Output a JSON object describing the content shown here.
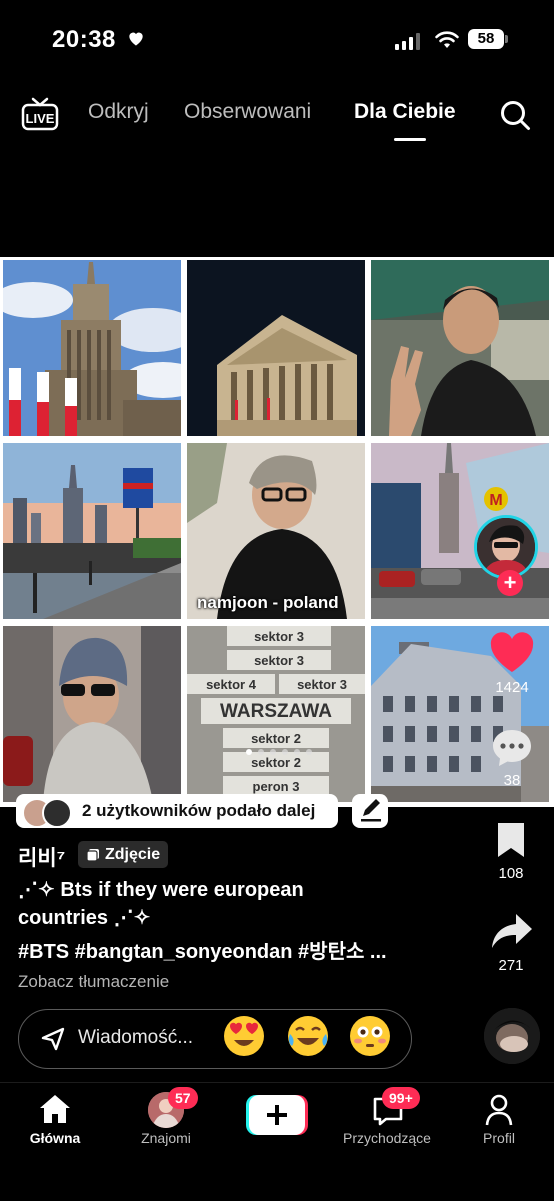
{
  "status_bar": {
    "time": "20:38",
    "battery": "58"
  },
  "top_nav": {
    "live_label": "LIVE",
    "tabs": [
      "Odkryj",
      "Obserwowani",
      "Dla Ciebie"
    ],
    "active_tab": "Dla Ciebie"
  },
  "post": {
    "tile_caption": "namjoon - poland",
    "signs": [
      "sektor 3",
      "sektor 3",
      "sektor 4",
      "sektor 3",
      "WARSZAWA",
      "sektor 2",
      "sektor 2",
      "peron 3"
    ],
    "reposted_by": "2 użytkowników podało dalej",
    "author": "리비⁷",
    "type_badge": "Zdjęcie",
    "caption_line1": "⋰✧ Bts if they were european",
    "caption_line2": "countries ⋰✧",
    "hashtags": "#BTS #bangtan_sonyeondan #방탄소 ...",
    "translate": "Zobacz tłumaczenie",
    "likes": "1424",
    "comments": "38",
    "bookmarks": "108",
    "shares": "271"
  },
  "message_bar": {
    "placeholder": "Wiadomość...",
    "emojis": [
      "heart-eyes",
      "tears-of-joy",
      "flushed"
    ]
  },
  "bottom_nav": {
    "items": [
      {
        "label": "Główna",
        "icon": "home-icon",
        "badge": ""
      },
      {
        "label": "Znajomi",
        "icon": "friends-icon",
        "badge": "57"
      },
      {
        "label": "",
        "icon": "plus-icon",
        "badge": ""
      },
      {
        "label": "Przychodzące",
        "icon": "inbox-icon",
        "badge": "99+"
      },
      {
        "label": "Profil",
        "icon": "profile-icon",
        "badge": ""
      }
    ]
  },
  "colors": {
    "accent": "#fe2c55",
    "live_ring": "#21d4e6"
  }
}
